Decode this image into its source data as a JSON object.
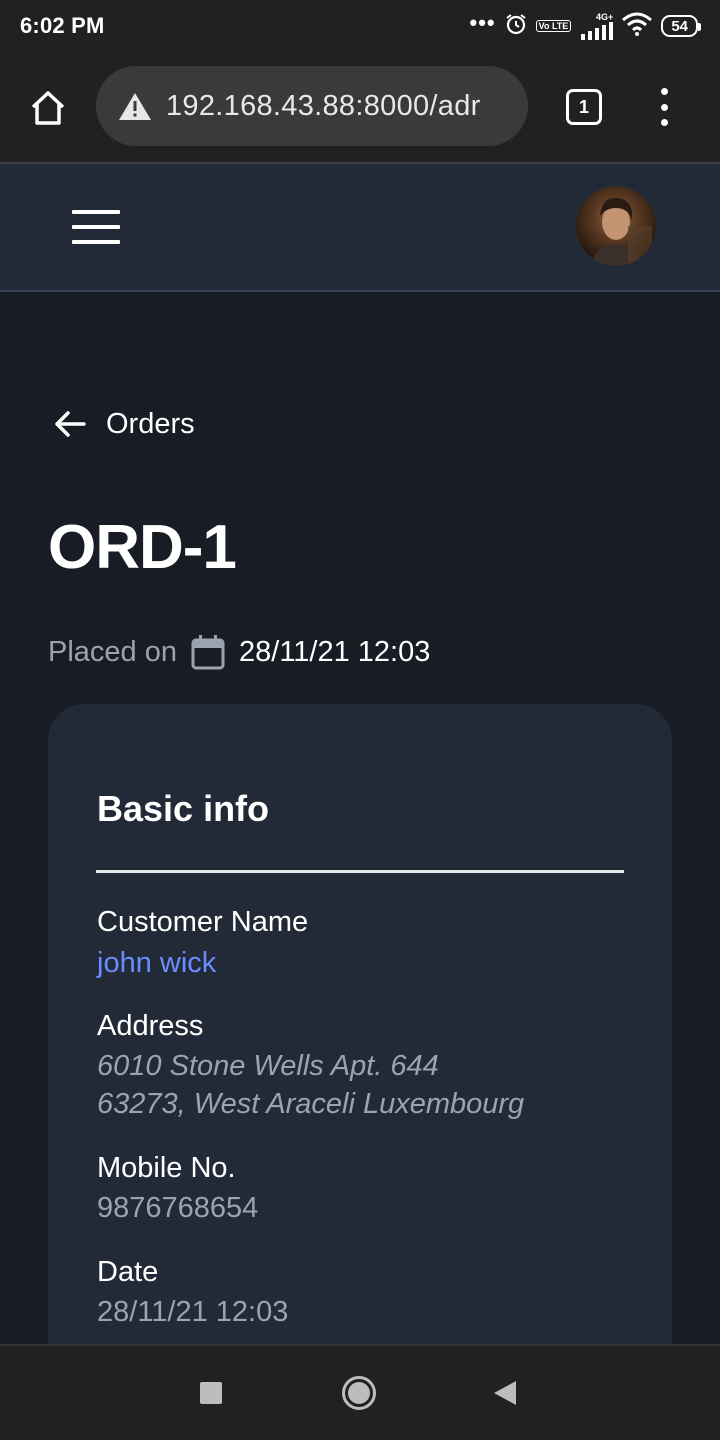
{
  "status_bar": {
    "time": "6:02 PM",
    "dots": "•••",
    "volte_badge": "Vo LTE",
    "network_label": "4G+",
    "battery": "54",
    "icons": [
      "alarm-icon",
      "signal-icon",
      "wifi-icon",
      "battery-icon"
    ]
  },
  "browser": {
    "url": "192.168.43.88:8000/adr",
    "tab_count": "1",
    "icons": [
      "home-icon",
      "warning-icon",
      "tabs-icon",
      "more-vert-icon"
    ]
  },
  "header": {
    "icons": [
      "hamburger-menu-icon",
      "avatar"
    ]
  },
  "breadcrumb": {
    "back_label": "Orders"
  },
  "order": {
    "title": "ORD-1",
    "placed_label": "Placed on",
    "placed_date": "28/11/21 12:03"
  },
  "basic_info": {
    "title": "Basic info",
    "customer_label": "Customer Name",
    "customer_value": "john wick",
    "address_label": "Address",
    "address_line1": "6010 Stone Wells Apt. 644",
    "address_line2": "63273, West Araceli Luxembourg",
    "mobile_label": "Mobile No.",
    "mobile_value": "9876768654",
    "date_label": "Date",
    "date_value": "28/11/21 12:03"
  },
  "colors": {
    "background": "#181c25",
    "header": "#222a38",
    "card": "#232a37",
    "link": "#6b8cff",
    "muted_text": "#9ca3af"
  }
}
